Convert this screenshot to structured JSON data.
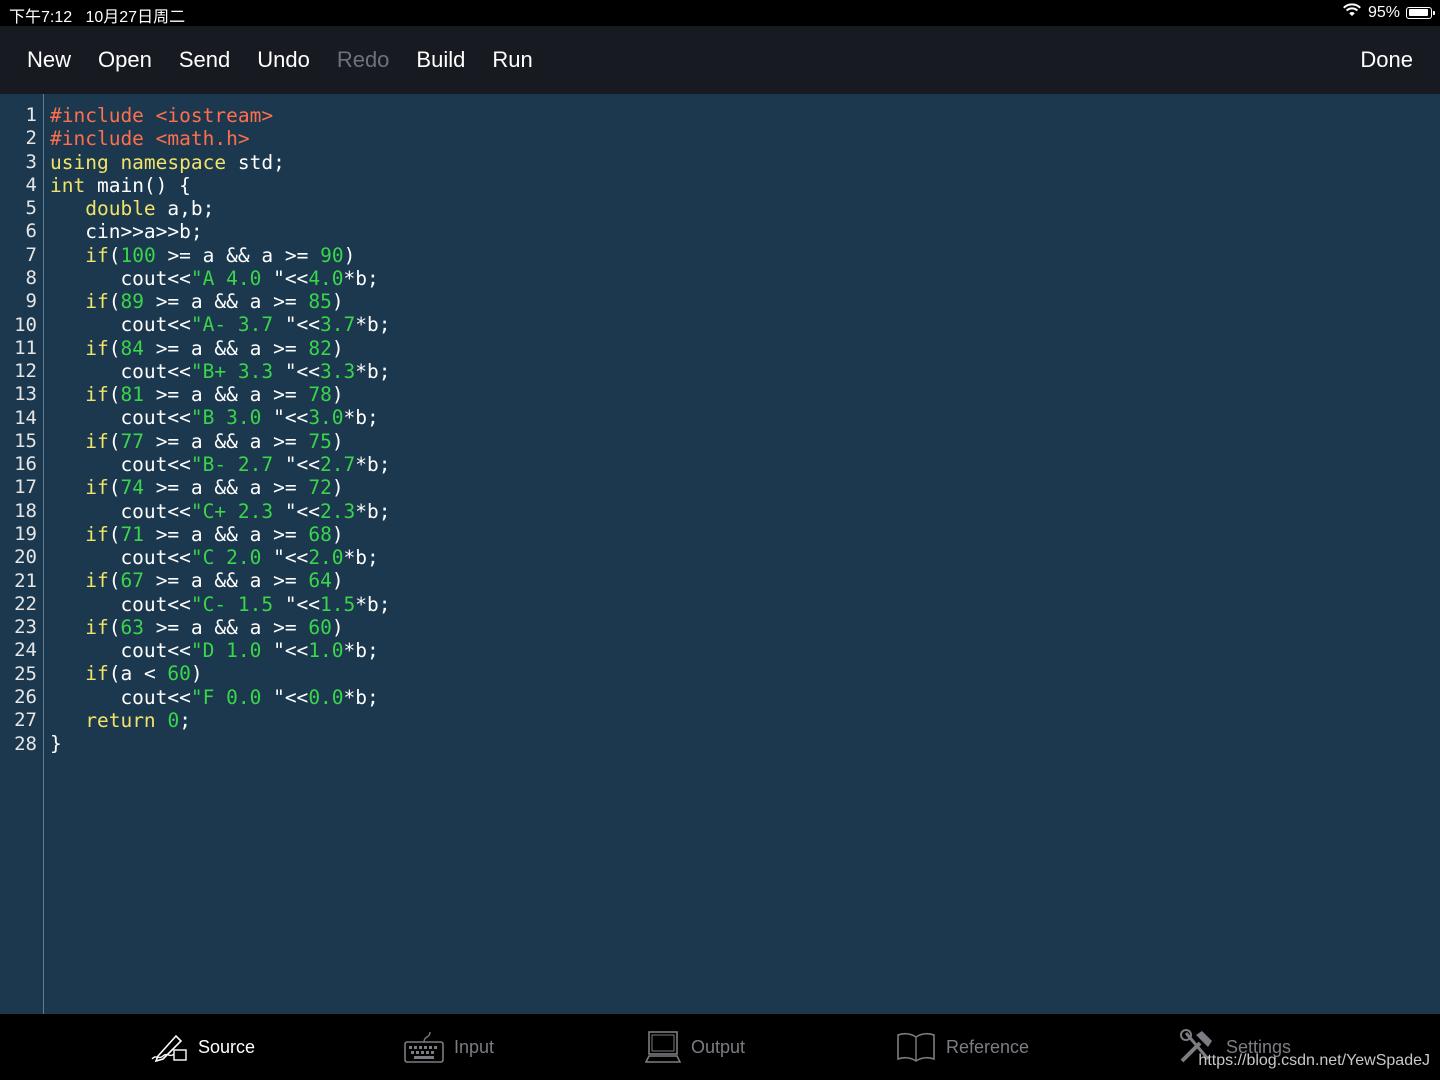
{
  "status": {
    "time_date": "下午7:12   10月27日周二",
    "battery": "95%",
    "battery_level": 0.95
  },
  "toolbar": {
    "buttons": [
      {
        "label": "New",
        "enabled": true
      },
      {
        "label": "Open",
        "enabled": true
      },
      {
        "label": "Send",
        "enabled": true
      },
      {
        "label": "Undo",
        "enabled": true
      },
      {
        "label": "Redo",
        "enabled": false
      },
      {
        "label": "Build",
        "enabled": true
      },
      {
        "label": "Run",
        "enabled": true
      }
    ],
    "done_label": "Done"
  },
  "editor": {
    "colors": {
      "background": "#1b384e",
      "preprocessor": "#ff6f4d",
      "keyword": "#f1e36a",
      "literal": "#39d54a",
      "text": "#ffffff"
    },
    "lines": [
      [
        {
          "t": "#include <iostream>",
          "c": "pre"
        }
      ],
      [
        {
          "t": "#include <math.h>",
          "c": "pre"
        }
      ],
      [
        {
          "t": "using namespace",
          "c": "kw"
        },
        {
          "t": " std;",
          "c": "plain"
        }
      ],
      [
        {
          "t": "int",
          "c": "kw"
        },
        {
          "t": " main() {",
          "c": "plain"
        }
      ],
      [
        {
          "t": "   ",
          "c": "plain"
        },
        {
          "t": "double",
          "c": "kw"
        },
        {
          "t": " a,b;",
          "c": "plain"
        }
      ],
      [
        {
          "t": "   cin>>a>>b;",
          "c": "plain"
        }
      ],
      [
        {
          "t": "   ",
          "c": "plain"
        },
        {
          "t": "if",
          "c": "kw"
        },
        {
          "t": "(",
          "c": "plain"
        },
        {
          "t": "100",
          "c": "num"
        },
        {
          "t": " >= a && a >= ",
          "c": "plain"
        },
        {
          "t": "90",
          "c": "num"
        },
        {
          "t": ")",
          "c": "plain"
        }
      ],
      [
        {
          "t": "      cout<<",
          "c": "plain"
        },
        {
          "t": "\"A 4.0 ",
          "c": "str"
        },
        {
          "t": "\"<<",
          "c": "plain"
        },
        {
          "t": "4.0",
          "c": "num"
        },
        {
          "t": "*b;",
          "c": "plain"
        }
      ],
      [
        {
          "t": "   ",
          "c": "plain"
        },
        {
          "t": "if",
          "c": "kw"
        },
        {
          "t": "(",
          "c": "plain"
        },
        {
          "t": "89",
          "c": "num"
        },
        {
          "t": " >= a && a >= ",
          "c": "plain"
        },
        {
          "t": "85",
          "c": "num"
        },
        {
          "t": ")",
          "c": "plain"
        }
      ],
      [
        {
          "t": "      cout<<",
          "c": "plain"
        },
        {
          "t": "\"A- 3.7 ",
          "c": "str"
        },
        {
          "t": "\"<<",
          "c": "plain"
        },
        {
          "t": "3.7",
          "c": "num"
        },
        {
          "t": "*b;",
          "c": "plain"
        }
      ],
      [
        {
          "t": "   ",
          "c": "plain"
        },
        {
          "t": "if",
          "c": "kw"
        },
        {
          "t": "(",
          "c": "plain"
        },
        {
          "t": "84",
          "c": "num"
        },
        {
          "t": " >= a && a >= ",
          "c": "plain"
        },
        {
          "t": "82",
          "c": "num"
        },
        {
          "t": ")",
          "c": "plain"
        }
      ],
      [
        {
          "t": "      cout<<",
          "c": "plain"
        },
        {
          "t": "\"B+ 3.3 ",
          "c": "str"
        },
        {
          "t": "\"<<",
          "c": "plain"
        },
        {
          "t": "3.3",
          "c": "num"
        },
        {
          "t": "*b;",
          "c": "plain"
        }
      ],
      [
        {
          "t": "   ",
          "c": "plain"
        },
        {
          "t": "if",
          "c": "kw"
        },
        {
          "t": "(",
          "c": "plain"
        },
        {
          "t": "81",
          "c": "num"
        },
        {
          "t": " >= a && a >= ",
          "c": "plain"
        },
        {
          "t": "78",
          "c": "num"
        },
        {
          "t": ")",
          "c": "plain"
        }
      ],
      [
        {
          "t": "      cout<<",
          "c": "plain"
        },
        {
          "t": "\"B 3.0 ",
          "c": "str"
        },
        {
          "t": "\"<<",
          "c": "plain"
        },
        {
          "t": "3.0",
          "c": "num"
        },
        {
          "t": "*b;",
          "c": "plain"
        }
      ],
      [
        {
          "t": "   ",
          "c": "plain"
        },
        {
          "t": "if",
          "c": "kw"
        },
        {
          "t": "(",
          "c": "plain"
        },
        {
          "t": "77",
          "c": "num"
        },
        {
          "t": " >= a && a >= ",
          "c": "plain"
        },
        {
          "t": "75",
          "c": "num"
        },
        {
          "t": ")",
          "c": "plain"
        }
      ],
      [
        {
          "t": "      cout<<",
          "c": "plain"
        },
        {
          "t": "\"B- 2.7 ",
          "c": "str"
        },
        {
          "t": "\"<<",
          "c": "plain"
        },
        {
          "t": "2.7",
          "c": "num"
        },
        {
          "t": "*b;",
          "c": "plain"
        }
      ],
      [
        {
          "t": "   ",
          "c": "plain"
        },
        {
          "t": "if",
          "c": "kw"
        },
        {
          "t": "(",
          "c": "plain"
        },
        {
          "t": "74",
          "c": "num"
        },
        {
          "t": " >= a && a >= ",
          "c": "plain"
        },
        {
          "t": "72",
          "c": "num"
        },
        {
          "t": ")",
          "c": "plain"
        }
      ],
      [
        {
          "t": "      cout<<",
          "c": "plain"
        },
        {
          "t": "\"C+ 2.3 ",
          "c": "str"
        },
        {
          "t": "\"<<",
          "c": "plain"
        },
        {
          "t": "2.3",
          "c": "num"
        },
        {
          "t": "*b;",
          "c": "plain"
        }
      ],
      [
        {
          "t": "   ",
          "c": "plain"
        },
        {
          "t": "if",
          "c": "kw"
        },
        {
          "t": "(",
          "c": "plain"
        },
        {
          "t": "71",
          "c": "num"
        },
        {
          "t": " >= a && a >= ",
          "c": "plain"
        },
        {
          "t": "68",
          "c": "num"
        },
        {
          "t": ")",
          "c": "plain"
        }
      ],
      [
        {
          "t": "      cout<<",
          "c": "plain"
        },
        {
          "t": "\"C 2.0 ",
          "c": "str"
        },
        {
          "t": "\"<<",
          "c": "plain"
        },
        {
          "t": "2.0",
          "c": "num"
        },
        {
          "t": "*b;",
          "c": "plain"
        }
      ],
      [
        {
          "t": "   ",
          "c": "plain"
        },
        {
          "t": "if",
          "c": "kw"
        },
        {
          "t": "(",
          "c": "plain"
        },
        {
          "t": "67",
          "c": "num"
        },
        {
          "t": " >= a && a >= ",
          "c": "plain"
        },
        {
          "t": "64",
          "c": "num"
        },
        {
          "t": ")",
          "c": "plain"
        }
      ],
      [
        {
          "t": "      cout<<",
          "c": "plain"
        },
        {
          "t": "\"C- 1.5 ",
          "c": "str"
        },
        {
          "t": "\"<<",
          "c": "plain"
        },
        {
          "t": "1.5",
          "c": "num"
        },
        {
          "t": "*b;",
          "c": "plain"
        }
      ],
      [
        {
          "t": "   ",
          "c": "plain"
        },
        {
          "t": "if",
          "c": "kw"
        },
        {
          "t": "(",
          "c": "plain"
        },
        {
          "t": "63",
          "c": "num"
        },
        {
          "t": " >= a && a >= ",
          "c": "plain"
        },
        {
          "t": "60",
          "c": "num"
        },
        {
          "t": ")",
          "c": "plain"
        }
      ],
      [
        {
          "t": "      cout<<",
          "c": "plain"
        },
        {
          "t": "\"D 1.0 ",
          "c": "str"
        },
        {
          "t": "\"<<",
          "c": "plain"
        },
        {
          "t": "1.0",
          "c": "num"
        },
        {
          "t": "*b;",
          "c": "plain"
        }
      ],
      [
        {
          "t": "   ",
          "c": "plain"
        },
        {
          "t": "if",
          "c": "kw"
        },
        {
          "t": "(a < ",
          "c": "plain"
        },
        {
          "t": "60",
          "c": "num"
        },
        {
          "t": ")",
          "c": "plain"
        }
      ],
      [
        {
          "t": "      cout<<",
          "c": "plain"
        },
        {
          "t": "\"F 0.0 ",
          "c": "str"
        },
        {
          "t": "\"<<",
          "c": "plain"
        },
        {
          "t": "0.0",
          "c": "num"
        },
        {
          "t": "*b;",
          "c": "plain"
        }
      ],
      [
        {
          "t": "   ",
          "c": "plain"
        },
        {
          "t": "return",
          "c": "kw"
        },
        {
          "t": " ",
          "c": "plain"
        },
        {
          "t": "0",
          "c": "num"
        },
        {
          "t": ";",
          "c": "plain"
        }
      ],
      [
        {
          "t": "}",
          "c": "plain"
        }
      ]
    ]
  },
  "tabs": [
    {
      "label": "Source",
      "icon": "source-pen-icon",
      "active": true
    },
    {
      "label": "Input",
      "icon": "keyboard-icon",
      "active": false
    },
    {
      "label": "Output",
      "icon": "monitor-icon",
      "active": false
    },
    {
      "label": "Reference",
      "icon": "book-icon",
      "active": false
    },
    {
      "label": "Settings",
      "icon": "tools-icon",
      "active": false
    }
  ],
  "watermark": "https://blog.csdn.net/YewSpadeJ"
}
